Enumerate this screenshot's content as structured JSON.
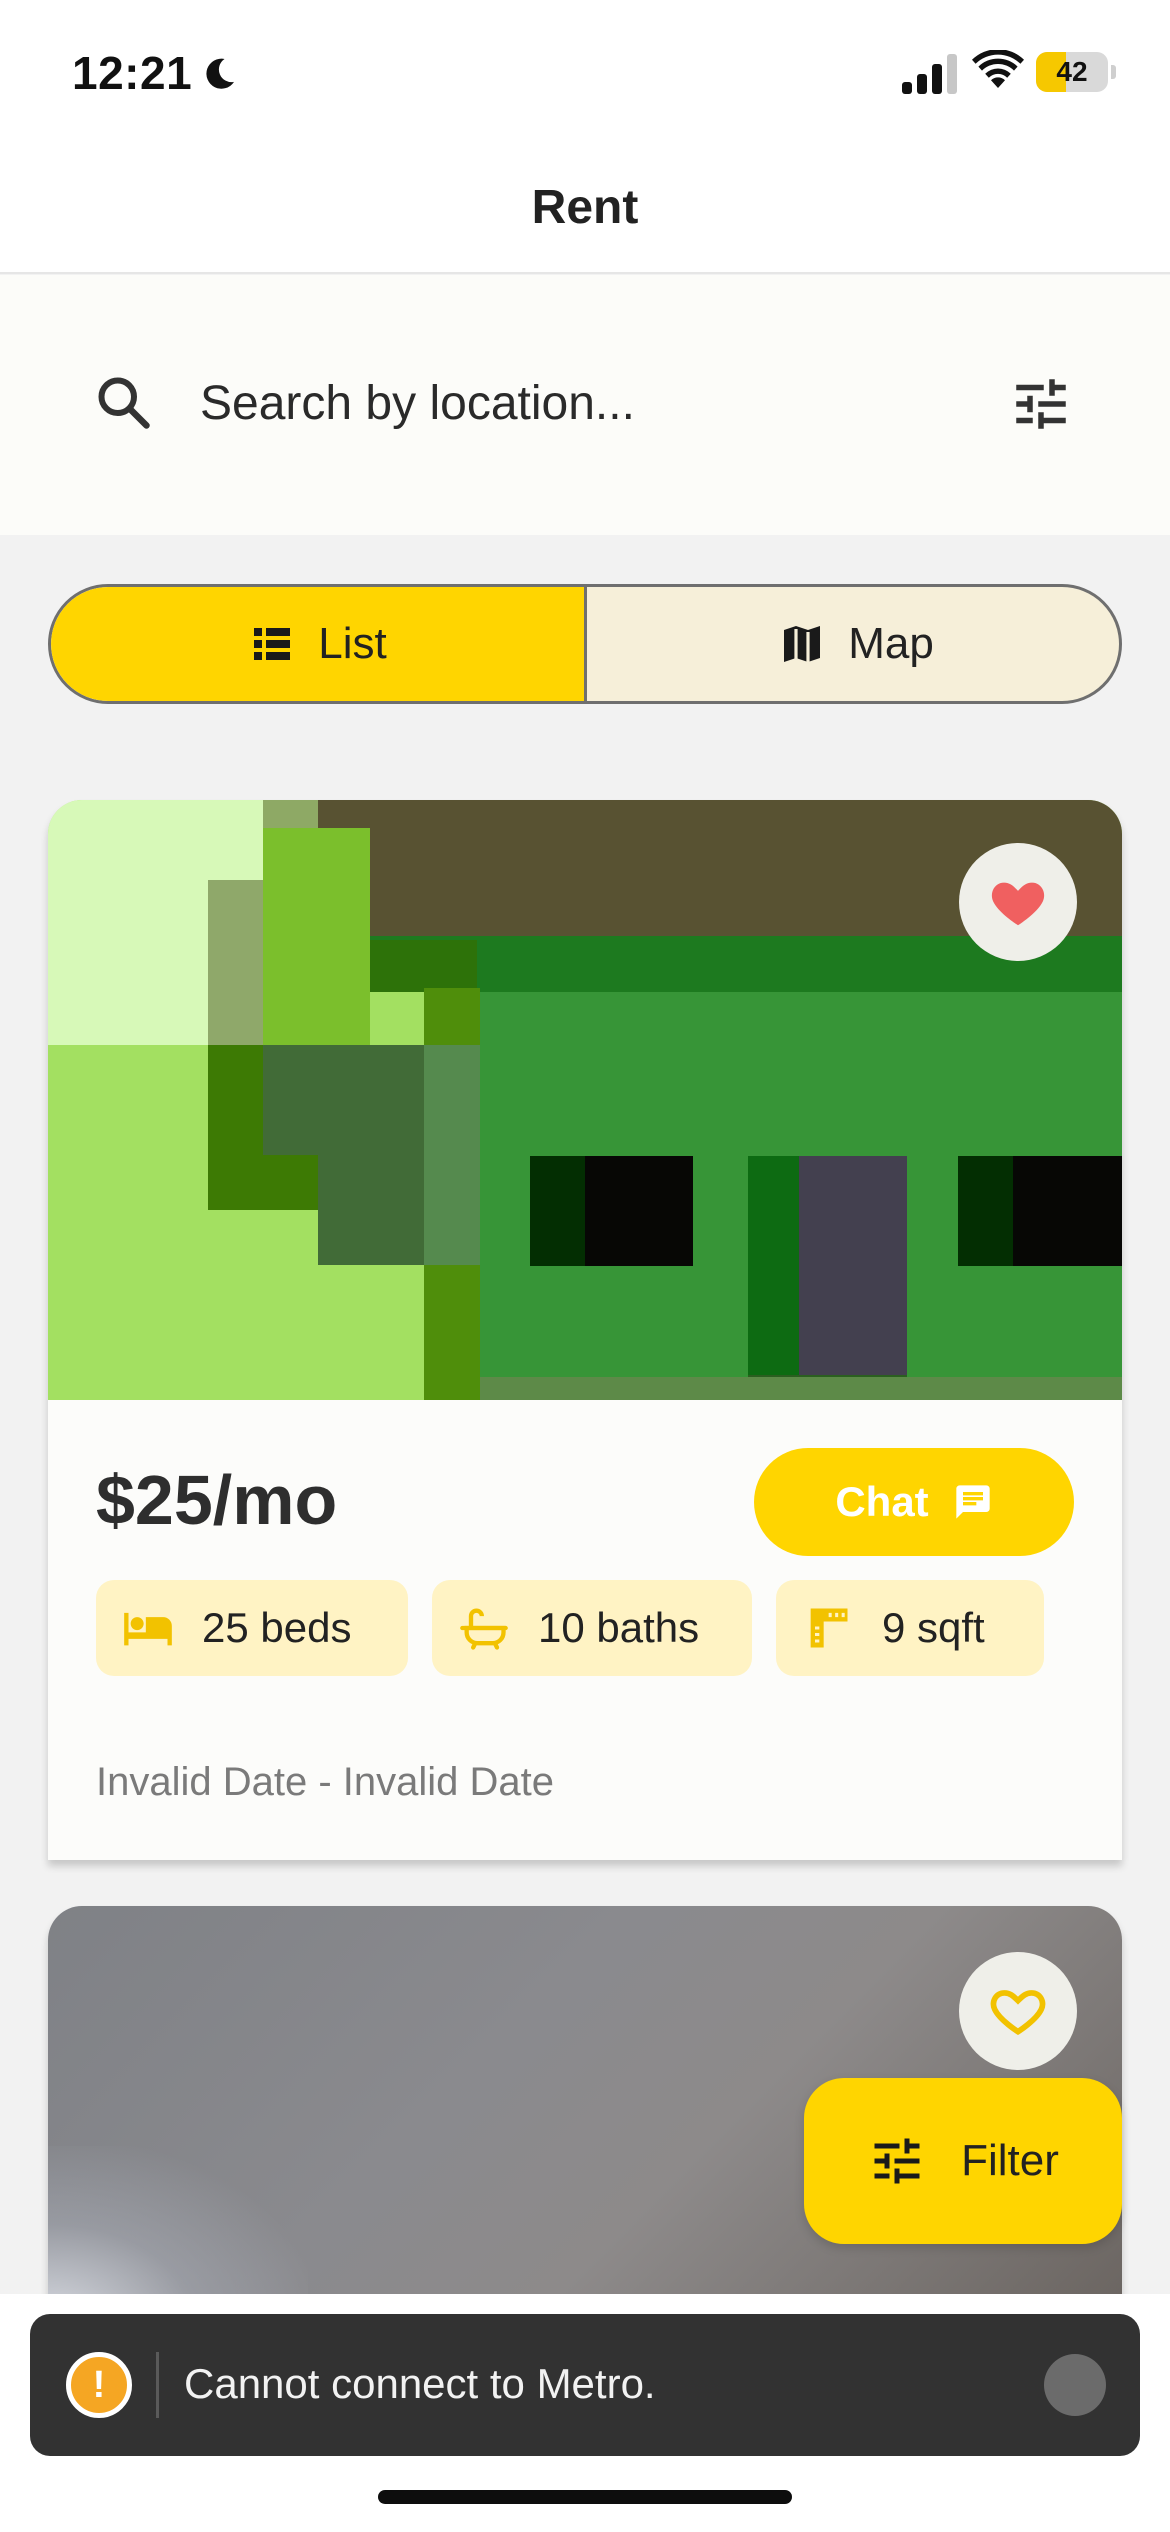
{
  "status_bar": {
    "time": "12:21",
    "battery": "42",
    "battery_level": 0.42,
    "icons": [
      "moon-icon",
      "signal-icon",
      "wifi-icon",
      "battery-icon"
    ]
  },
  "header": {
    "title": "Rent"
  },
  "search": {
    "placeholder": "Search by location...",
    "value": ""
  },
  "view_toggle": {
    "list_label": "List",
    "map_label": "Map",
    "selected": "List"
  },
  "listings": [
    {
      "price": "$25/mo",
      "chat_label": "Chat",
      "beds": "25 beds",
      "baths": "10 baths",
      "area": "9 sqft",
      "dates": "Invalid Date - Invalid Date",
      "favorited": true
    },
    {
      "favorited": false
    }
  ],
  "fab": {
    "label": "Filter"
  },
  "toast": {
    "message": "Cannot connect to Metro.",
    "icon": "!"
  },
  "colors": {
    "accent": "#ffd500",
    "chip_bg": "#fff3c4",
    "heart_filled": "#f06060",
    "heart_outline": "#f2c200"
  }
}
